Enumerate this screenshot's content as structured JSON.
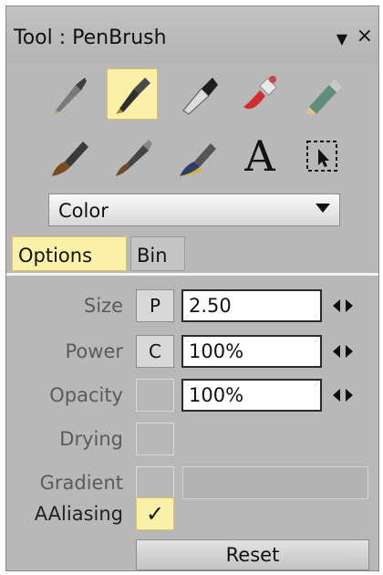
{
  "panel": {
    "title": "Tool : PenBrush",
    "menu_icon": "triangle-down-icon",
    "close_icon": "×"
  },
  "tools": {
    "row1": [
      "pen-nib-icon",
      "pen-brush-icon",
      "marker-icon",
      "paint-tube-icon",
      "pencil-icon"
    ],
    "row2": [
      "flat-brush-icon",
      "round-brush-icon",
      "blend-brush-icon",
      "text-icon",
      "select-icon"
    ],
    "selected": "pen-brush-icon",
    "text_glyph": "A"
  },
  "color_dropdown": {
    "value": "Color"
  },
  "tabs": [
    {
      "label": "Options",
      "active": true
    },
    {
      "label": "Bin",
      "active": false
    }
  ],
  "options": {
    "size": {
      "label": "Size",
      "mode": "P",
      "value": "2.50"
    },
    "power": {
      "label": "Power",
      "mode": "C",
      "value": "100%"
    },
    "opacity": {
      "label": "Opacity",
      "mode": "",
      "value": "100%"
    },
    "drying": {
      "label": "Drying"
    },
    "gradient": {
      "label": "Gradient"
    },
    "aaliasing": {
      "label": "AAliasing",
      "checked": true,
      "check_glyph": "✓"
    },
    "reset_label": "Reset"
  },
  "colors": {
    "panel_bg": "#b8b8b8",
    "highlight": "#fbf0a8"
  }
}
